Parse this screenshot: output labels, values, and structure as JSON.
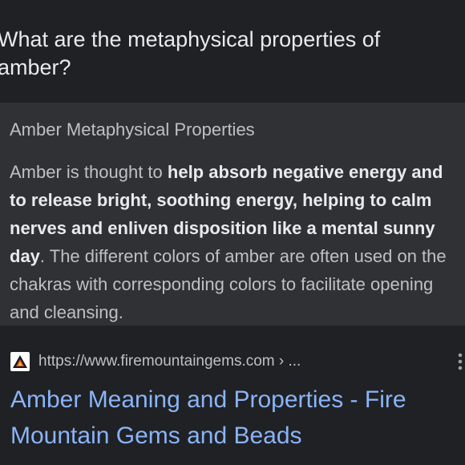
{
  "question": "What are the metaphysical properties of amber?",
  "snippet": {
    "title": "Amber Metaphysical Properties",
    "body_pre": "Amber is thought to ",
    "body_bold": "help absorb negative energy and to release bright, soothing energy, helping to calm nerves and enliven disposition like a mental sunny day",
    "body_post": ". The different colors of amber are often used on the chakras with corresponding colors to facilitate opening and cleansing."
  },
  "result": {
    "favicon_icon": "mountain-logo-icon",
    "url": "https://www.firemountaingems.com › ...",
    "title": "Amber Meaning and Properties - Fire Mountain Gems and Beads",
    "more_icon": "vertical-ellipsis-icon"
  },
  "colors": {
    "background": "#202124",
    "snippet_background": "#303134",
    "link": "#8ab4f8",
    "text": "#bdc1c6"
  }
}
